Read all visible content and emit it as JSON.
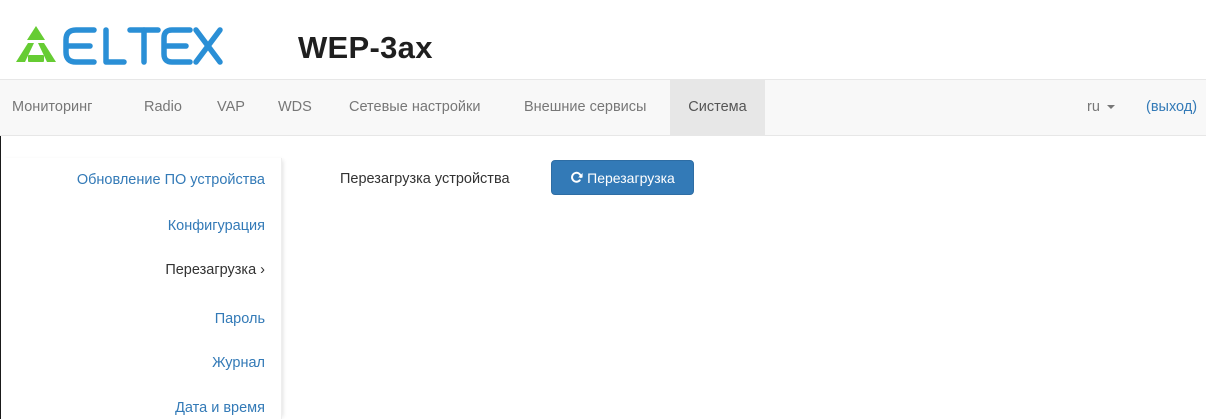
{
  "header": {
    "logo_text": "ELTEX",
    "model": "WEP-3ax",
    "brand_color": "#66cc33",
    "logo_color": "#2a8fd6"
  },
  "nav": {
    "items": [
      {
        "label": "Мониторинг"
      },
      {
        "label": "Radio"
      },
      {
        "label": "VAP"
      },
      {
        "label": "WDS"
      },
      {
        "label": "Сетевые настройки"
      },
      {
        "label": "Внешние сервисы"
      },
      {
        "label": "Система",
        "active": true
      }
    ],
    "language": "ru",
    "logout": "(выход)"
  },
  "sidebar": {
    "items": [
      {
        "label": "Обновление ПО устройства"
      },
      {
        "label": "Конфигурация"
      },
      {
        "label": "Перезагрузка ›",
        "active": true
      },
      {
        "label": "Пароль"
      },
      {
        "label": "Журнал"
      },
      {
        "label": "Дата и время"
      }
    ]
  },
  "main": {
    "reboot_label": "Перезагрузка устройства",
    "reboot_button": "Перезагрузка",
    "reboot_icon": "refresh-icon",
    "accent_color": "#337ab7"
  }
}
